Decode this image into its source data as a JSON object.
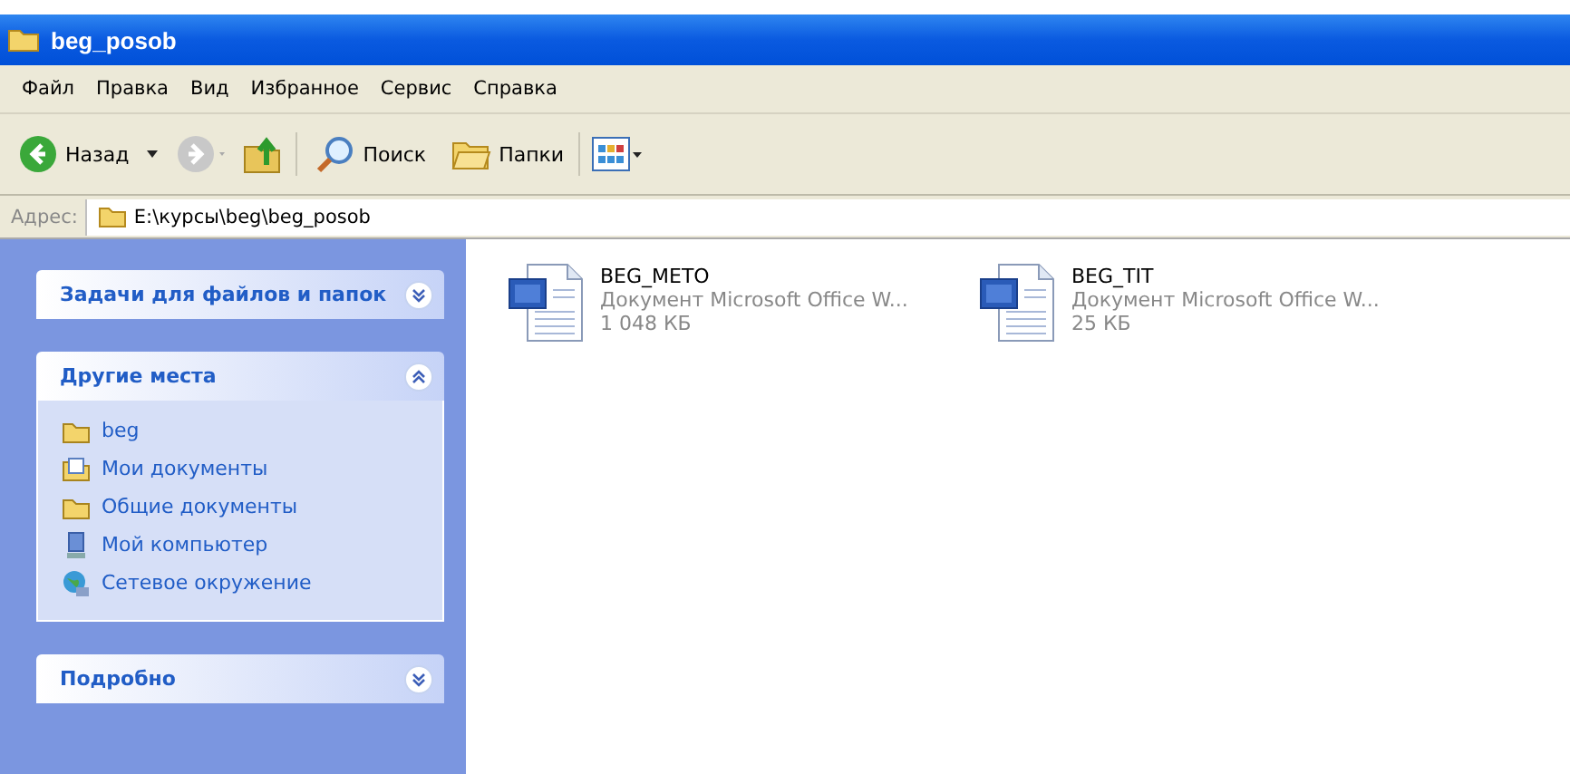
{
  "window": {
    "title": "beg_posob"
  },
  "menu": [
    "Файл",
    "Правка",
    "Вид",
    "Избранное",
    "Сервис",
    "Справка"
  ],
  "toolbar": [
    {
      "kind": "back",
      "label": "Назад"
    },
    {
      "kind": "forward"
    },
    {
      "kind": "up"
    },
    {
      "kind": "search",
      "label": "Поиск"
    },
    {
      "kind": "folders",
      "label": "Папки"
    },
    {
      "kind": "views"
    }
  ],
  "address": {
    "label": "Адрес:",
    "value": "E:\\курсы\\beg\\beg_posob"
  },
  "task_panels": [
    {
      "title": "Задачи для файлов и папок",
      "expanded": false
    },
    {
      "title": "Другие места",
      "expanded": true,
      "items": [
        {
          "kind": "folder",
          "label": "beg"
        },
        {
          "kind": "documents",
          "label": "Мои документы"
        },
        {
          "kind": "folder",
          "label": "Общие документы"
        },
        {
          "kind": "computer",
          "label": "Мой компьютер"
        },
        {
          "kind": "network",
          "label": "Сетевое окружение"
        }
      ]
    },
    {
      "title": "Подробно",
      "expanded": false
    }
  ],
  "files": [
    {
      "name": "BEG_METO",
      "type": "Документ Microsoft Office W...",
      "size": "1 048 КБ"
    },
    {
      "name": "BEG_TIT",
      "type": "Документ Microsoft Office W...",
      "size": "25 КБ"
    }
  ]
}
